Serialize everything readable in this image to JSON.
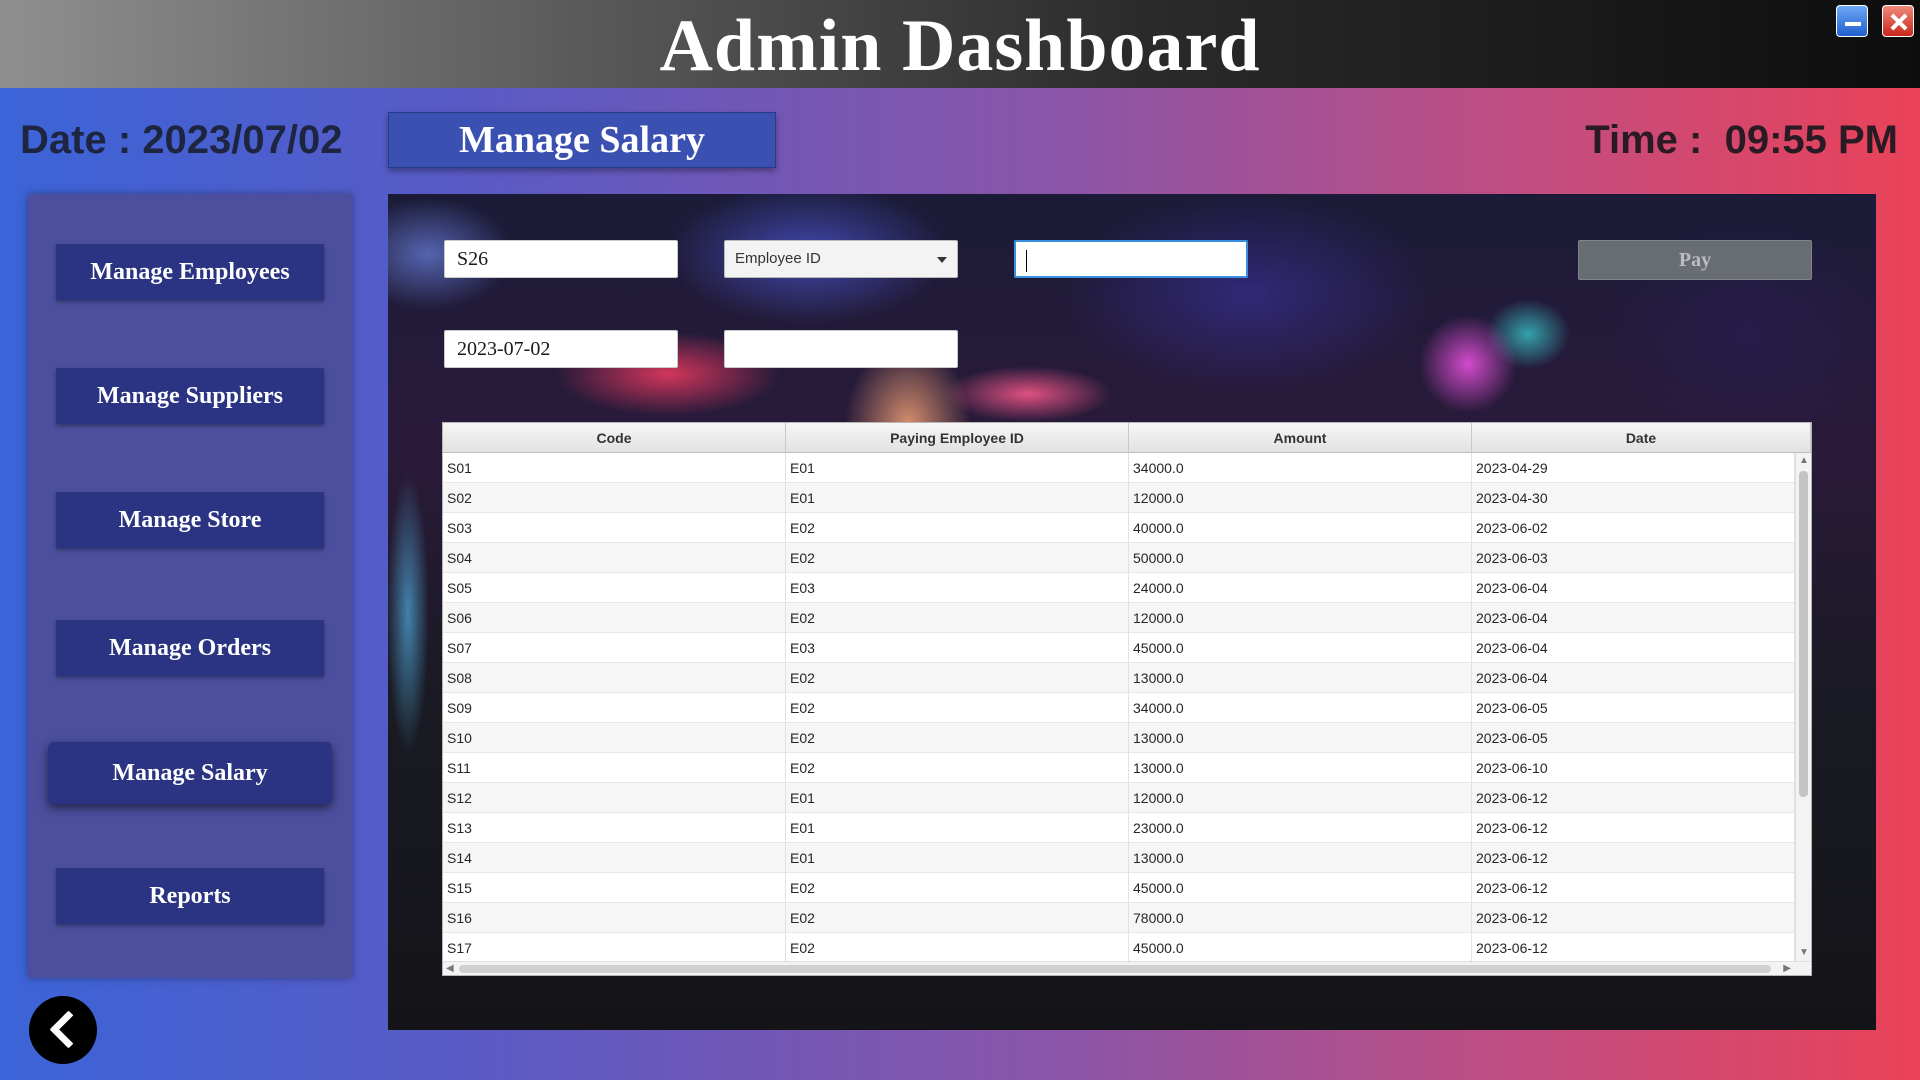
{
  "app": {
    "title": "Admin Dashboard"
  },
  "header": {
    "date_label": "Date : 2023/07/02",
    "time_label": "Time :  09:55 PM",
    "section_title": "Manage Salary"
  },
  "sidebar": {
    "items": [
      {
        "label": "Manage Employees"
      },
      {
        "label": "Manage Suppliers"
      },
      {
        "label": "Manage Store"
      },
      {
        "label": "Manage Orders"
      },
      {
        "label": "Manage Salary",
        "active": true
      },
      {
        "label": "Reports"
      }
    ]
  },
  "form": {
    "code_value": "S26",
    "employee_select_value": "Employee ID",
    "amount_value": "",
    "date_value": "2023-07-02",
    "extra_value": "",
    "pay_label": "Pay"
  },
  "table": {
    "columns": [
      "Code",
      "Paying Employee ID",
      "Amount",
      "Date"
    ],
    "rows": [
      [
        "S01",
        "E01",
        "34000.0",
        "2023-04-29"
      ],
      [
        "S02",
        "E01",
        "12000.0",
        "2023-04-30"
      ],
      [
        "S03",
        "E02",
        "40000.0",
        "2023-06-02"
      ],
      [
        "S04",
        "E02",
        "50000.0",
        "2023-06-03"
      ],
      [
        "S05",
        "E03",
        "24000.0",
        "2023-06-04"
      ],
      [
        "S06",
        "E02",
        "12000.0",
        "2023-06-04"
      ],
      [
        "S07",
        "E03",
        "45000.0",
        "2023-06-04"
      ],
      [
        "S08",
        "E02",
        "13000.0",
        "2023-06-04"
      ],
      [
        "S09",
        "E02",
        "34000.0",
        "2023-06-05"
      ],
      [
        "S10",
        "E02",
        "13000.0",
        "2023-06-05"
      ],
      [
        "S11",
        "E02",
        "13000.0",
        "2023-06-10"
      ],
      [
        "S12",
        "E01",
        "12000.0",
        "2023-06-12"
      ],
      [
        "S13",
        "E01",
        "23000.0",
        "2023-06-12"
      ],
      [
        "S14",
        "E01",
        "13000.0",
        "2023-06-12"
      ],
      [
        "S15",
        "E02",
        "45000.0",
        "2023-06-12"
      ],
      [
        "S16",
        "E02",
        "78000.0",
        "2023-06-12"
      ],
      [
        "S17",
        "E02",
        "45000.0",
        "2023-06-12"
      ]
    ]
  },
  "icons": {
    "minimize": "minimize-icon",
    "close": "close-icon",
    "back": "back-arrow-icon",
    "dropdown": "chevron-down-icon"
  },
  "colors": {
    "nav_button": "#2a3482",
    "section_title_bg": "#3a51b2",
    "sidebar_bg": "#4b4f9e"
  }
}
